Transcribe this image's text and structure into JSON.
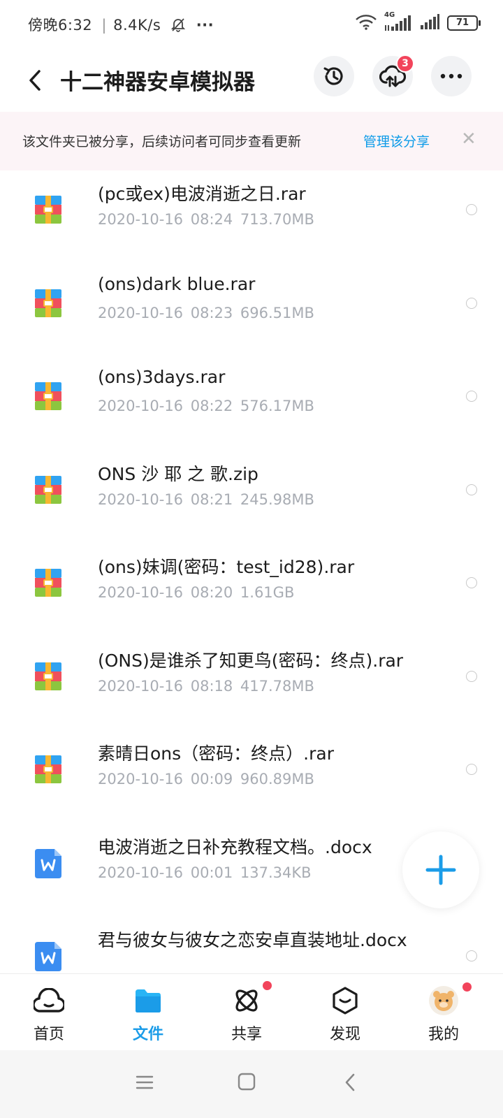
{
  "status_bar": {
    "time": "傍晚6:32",
    "net_speed": "8.4K/s",
    "more": "···",
    "network_type": "4G",
    "battery": "71"
  },
  "header": {
    "title": "十二神器安卓模拟器",
    "transfer_badge": "3"
  },
  "share_banner": {
    "message": "该文件夹已被分享，后续访问者可同步查看更新",
    "link": "管理该分享",
    "close": "✕"
  },
  "files": [
    {
      "name": "(pc或ex)电波消逝之日.rar",
      "meta": "2020-10-16  08:24  713.70MB",
      "type": "archive"
    },
    {
      "name": "(ons)dark blue.rar",
      "meta": "2020-10-16  08:23  696.51MB",
      "type": "archive"
    },
    {
      "name": "(ons)3days.rar",
      "meta": "2020-10-16  08:22  576.17MB",
      "type": "archive"
    },
    {
      "name": "ONS 沙  耶  之  歌.zip",
      "meta": "2020-10-16  08:21  245.98MB",
      "type": "archive"
    },
    {
      "name": "(ons)妹调(密码：test_id28).rar",
      "meta": "2020-10-16  08:20  1.61GB",
      "type": "archive"
    },
    {
      "name": "(ONS)是谁杀了知更鸟(密码：终点).rar",
      "meta": "2020-10-16  08:18  417.78MB",
      "type": "archive"
    },
    {
      "name": "素晴日ons（密码：终点）.rar",
      "meta": "2020-10-16  00:09  960.89MB",
      "type": "archive"
    },
    {
      "name": "电波消逝之日补充教程文档。.docx",
      "meta": "2020-10-16  00:01  137.34KB",
      "type": "word"
    },
    {
      "name": "君与彼女与彼女之恋安卓直装地址.docx",
      "meta": "",
      "type": "word"
    }
  ],
  "bottom_nav": [
    {
      "label": "首页",
      "icon": "cloud-home-icon",
      "active": false
    },
    {
      "label": "文件",
      "icon": "folder-icon",
      "active": true
    },
    {
      "label": "共享",
      "icon": "atom-share-icon",
      "active": false
    },
    {
      "label": "发现",
      "icon": "discover-box-icon",
      "active": false
    },
    {
      "label": "我的",
      "icon": "avatar",
      "active": false
    }
  ],
  "colors": {
    "accent": "#1b9ce8",
    "badge": "#f2445b",
    "banner_bg": "#fcf4f7"
  }
}
